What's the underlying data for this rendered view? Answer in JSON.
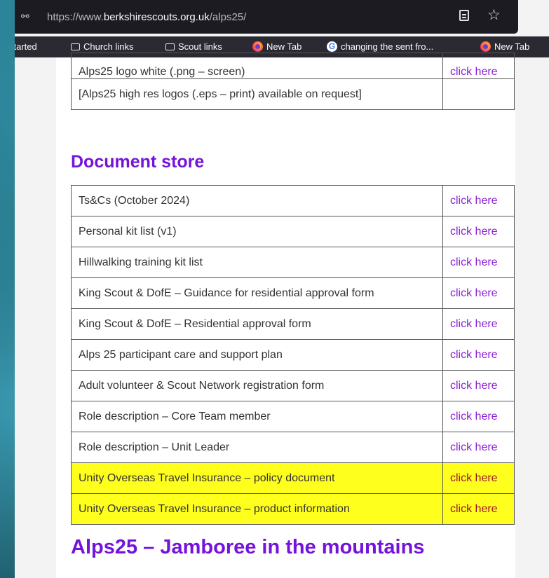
{
  "browser": {
    "url_prefix": "https://www.",
    "url_domain": "berkshirescouts.org.uk",
    "url_path": "/alps25/",
    "bookmarks": [
      "g Started",
      "Church links",
      "Scout links",
      "New Tab",
      "changing the sent fro...",
      "New Tab"
    ]
  },
  "logos_table": {
    "rows": [
      {
        "name": "Alps25 logo white (.png – screen)",
        "link": "click here"
      },
      {
        "name": "[Alps25 high res logos (.eps – print) available on request]",
        "link": ""
      }
    ]
  },
  "document_store": {
    "heading": "Document store",
    "rows": [
      {
        "name": "Ts&Cs (October 2024)",
        "link": "click here"
      },
      {
        "name": "Personal kit list (v1)",
        "link": "click here"
      },
      {
        "name": "Hillwalking training kit list",
        "link": "click here"
      },
      {
        "name": "King Scout & DofE – Guidance for residential approval form",
        "link": "click here"
      },
      {
        "name": "King Scout & DofE – Residential approval form",
        "link": "click here"
      },
      {
        "name": "Alps 25 participant care and support plan",
        "link": "click here"
      },
      {
        "name": "Adult volunteer & Scout Network registration form",
        "link": "click here"
      },
      {
        "name": "Role description – Core Team member",
        "link": "click here"
      },
      {
        "name": "Role description – Unit Leader",
        "link": "click here"
      },
      {
        "name": "Unity Overseas Travel Insurance – policy document",
        "link": "click here",
        "highlighted": true
      },
      {
        "name": "Unity Overseas Travel Insurance – product information",
        "link": "click here",
        "highlighted": true
      }
    ]
  },
  "next_heading": "Alps25 – Jamboree in the mountains",
  "colors": {
    "heading": "#7413dc",
    "link": "#8b1fd6",
    "highlight": "#ffff1e"
  }
}
